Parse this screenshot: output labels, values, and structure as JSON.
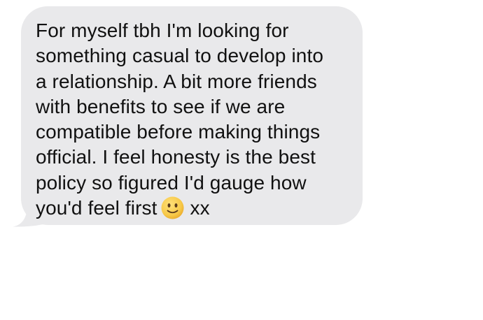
{
  "message": {
    "sender": "received",
    "lines": [
      "For myself tbh I'm looking for",
      "something casual to develop into",
      "a relationship. A bit more friends",
      "with benefits to see if we are",
      "compatible before making things",
      "official. I feel honesty is the best",
      "policy so figured I'd gauge how"
    ],
    "last_line": {
      "before_emoji": "you'd feel first",
      "emoji": "slightly-smiling-face",
      "after_emoji": "xx"
    }
  },
  "colors": {
    "bubble": "#e9e9eb",
    "text": "#111111",
    "background": "#ffffff",
    "emoji_face": "#f7c948"
  }
}
